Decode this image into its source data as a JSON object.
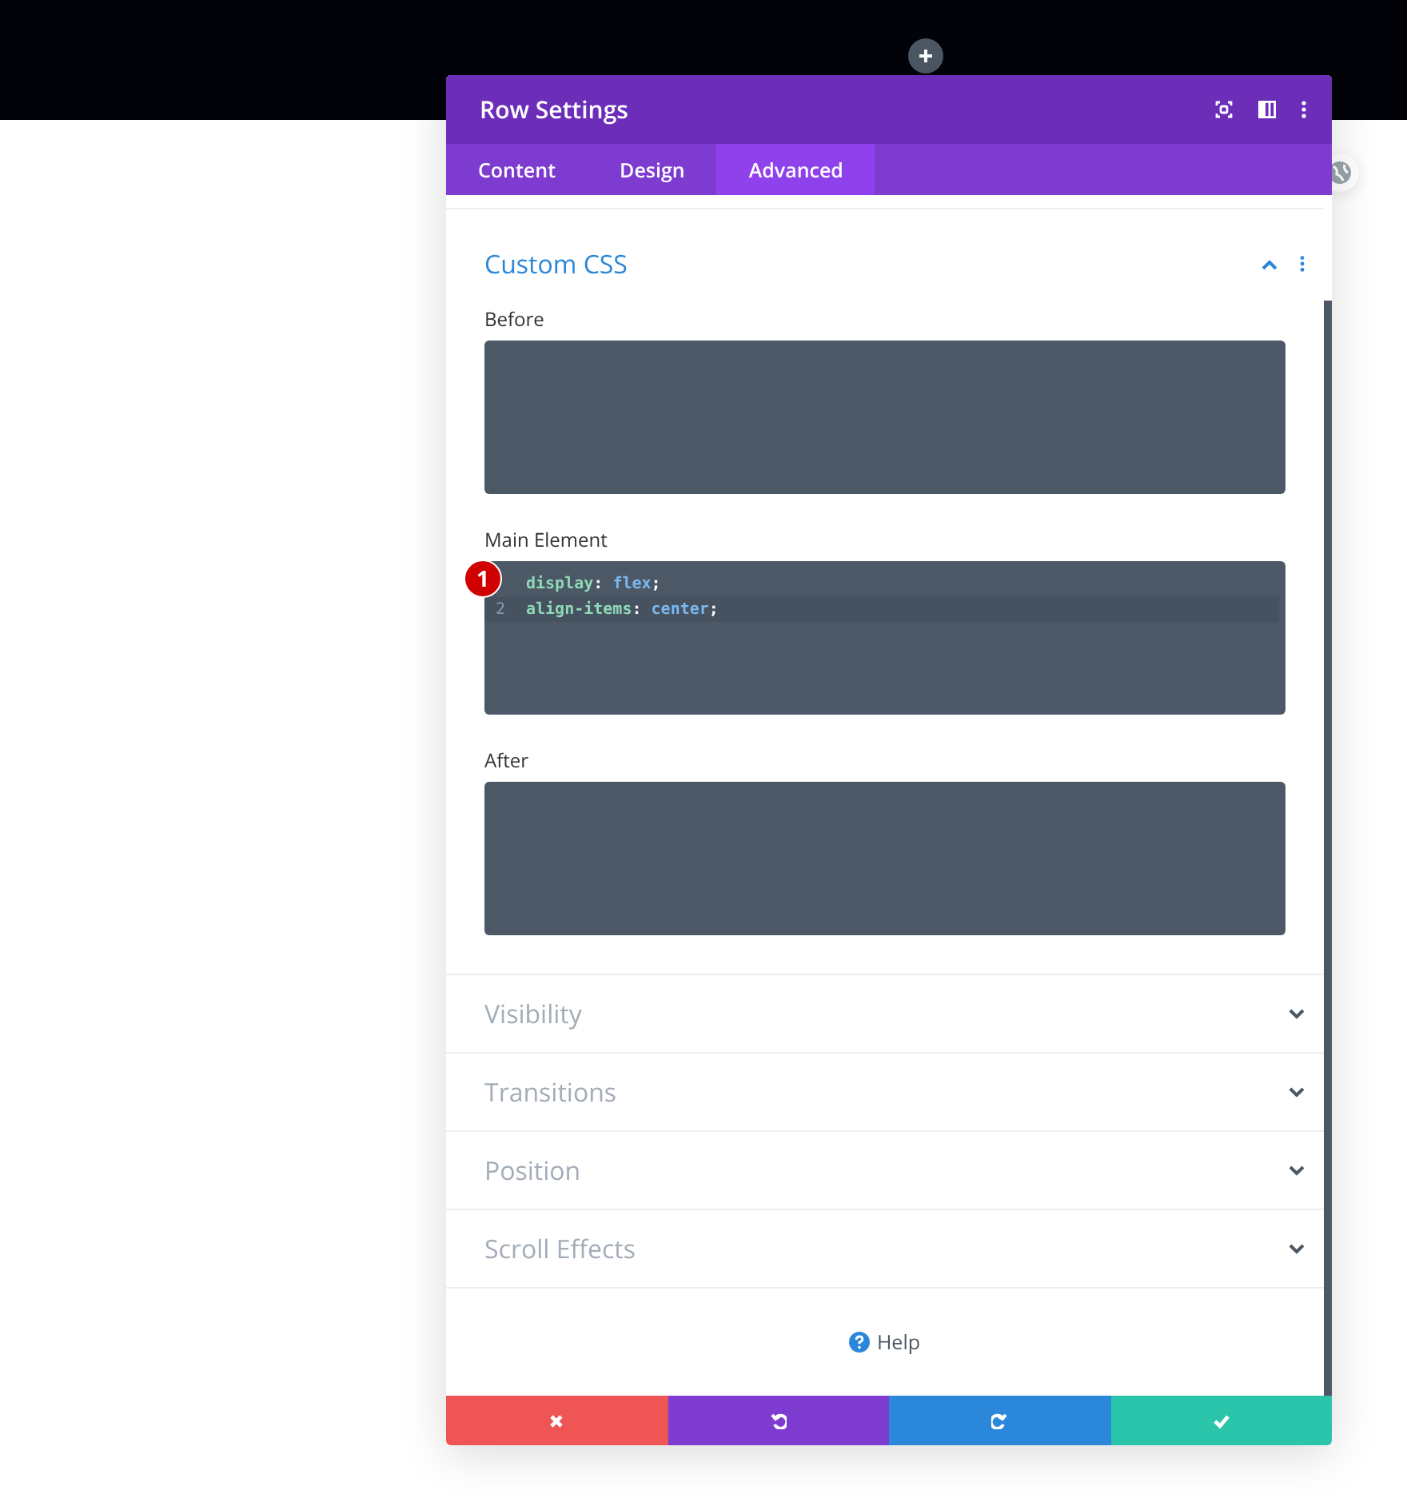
{
  "window": {
    "title": "Row Settings"
  },
  "tabs": [
    {
      "label": "Content",
      "selected": false
    },
    {
      "label": "Design",
      "selected": false
    },
    {
      "label": "Advanced",
      "selected": true
    }
  ],
  "sections": [
    {
      "title": "Custom CSS",
      "expanded": true,
      "fields": [
        {
          "label": "Before"
        },
        {
          "label": "Main Element",
          "badge": "1",
          "lines": [
            {
              "active": false,
              "tokens": [
                {
                  "text": "display",
                  "kind": "property"
                },
                {
                  "text": ": ",
                  "kind": "punct"
                },
                {
                  "text": "flex",
                  "kind": "value"
                },
                {
                  "text": ";",
                  "kind": "punct"
                }
              ]
            },
            {
              "number": "2",
              "active": true,
              "tokens": [
                {
                  "text": "align-items",
                  "kind": "property"
                },
                {
                  "text": ": ",
                  "kind": "punct"
                },
                {
                  "text": "center",
                  "kind": "value"
                },
                {
                  "text": ";",
                  "kind": "punct"
                }
              ]
            }
          ]
        },
        {
          "label": "After"
        }
      ]
    },
    {
      "title": "Visibility",
      "expanded": false
    },
    {
      "title": "Transitions",
      "expanded": false
    },
    {
      "title": "Position",
      "expanded": false
    },
    {
      "title": "Scroll Effects",
      "expanded": false
    }
  ],
  "help": "Help",
  "footer_buttons": [
    {
      "kind": "cancel"
    },
    {
      "kind": "undo"
    },
    {
      "kind": "redo"
    },
    {
      "kind": "save"
    }
  ]
}
